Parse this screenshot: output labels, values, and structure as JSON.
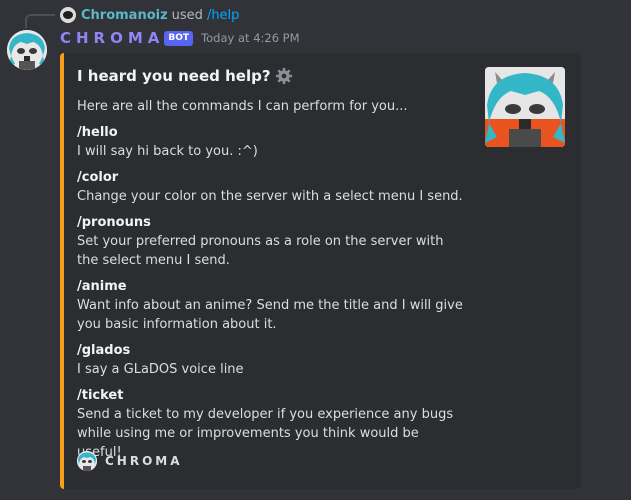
{
  "reply": {
    "user": "Chromanoiz",
    "used_text": "used",
    "command": "/help"
  },
  "message": {
    "author": "CHROMA",
    "badge": "BOT",
    "timestamp": "Today at 4:26 PM"
  },
  "embed": {
    "accent_color": "#f99e1a",
    "title": "I heard you need help?",
    "title_icon": "gear-icon",
    "intro": "Here are all the commands I can perform for you...",
    "commands": [
      {
        "name": "/hello",
        "text": "I will say hi back to you. :^)"
      },
      {
        "name": "/color",
        "text": "Change your color on the server with a select menu I send."
      },
      {
        "name": "/pronouns",
        "text": "Set your preferred pronouns as a role on the server with the select menu I send."
      },
      {
        "name": "/anime",
        "text": "Want info about an anime? Send me the title and I will give you basic information about it."
      },
      {
        "name": "/glados",
        "text": "I say a GLaDOS voice line"
      },
      {
        "name": "/ticket",
        "text": "Send a ticket to my developer if you experience any bugs while using me or improvements you think would be useful!"
      }
    ],
    "footer": "CHROMA"
  }
}
